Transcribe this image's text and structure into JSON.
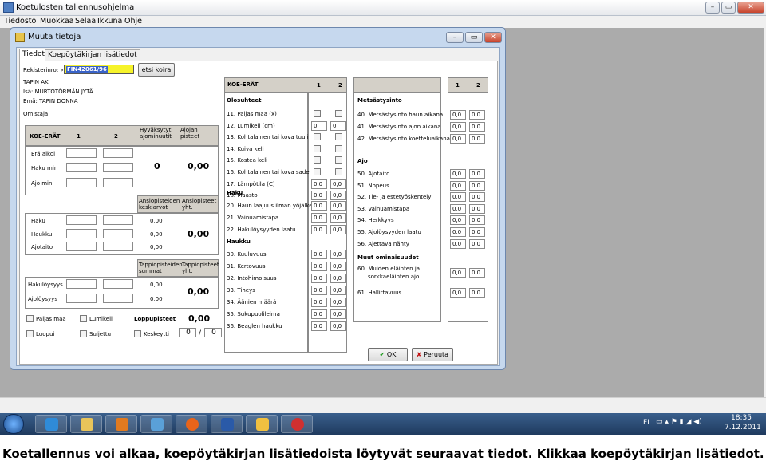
{
  "main_window": {
    "title": "Koetulosten tallennusohjelma",
    "menu": [
      "Tiedosto",
      "Muokkaa",
      "Selaa",
      "Ikkuna",
      "Ohje"
    ]
  },
  "dialog": {
    "title": "Muuta tietoja",
    "tabs": [
      "Tiedot",
      "Koepöytäkirjan lisätiedot"
    ],
    "reg_label": "Rekisterinro: »",
    "reg_value": "FIN42061/96",
    "find_button": "etsi koira",
    "dog_name": "TAPIN AKI",
    "sire": "Isä:   MURTOTÖRMÄN JYTÄ",
    "dam": "Emä:  TAPIN DONNA",
    "owner_label": "Omistaja:",
    "left": {
      "header": "KOE-ERÄT",
      "col1": "1",
      "col2": "2",
      "approved": "Hyväksytyt ajominuutit",
      "drive_pts": "Ajojan pisteet",
      "rows": [
        "Erä alkoi",
        "Haku min",
        "Ajo min"
      ],
      "approved_val": "0",
      "drive_val": "0,00",
      "income_avg": "Ansiopisteiden keskiarvot",
      "income_tot": "Ansiopisteet yht.",
      "income_rows": [
        "Haku",
        "Haukku",
        "Ajotaito"
      ],
      "income_vals": [
        "0,00",
        "0,00",
        "0,00"
      ],
      "income_total": "0,00",
      "loss_sum": "Tappiopisteiden summat",
      "loss_tot": "Tappiopisteet yht.",
      "loss_rows": [
        "Hakulöysyys",
        "Ajolöysyys"
      ],
      "loss_vals": [
        "0,00",
        "0,00"
      ],
      "loss_total": "0,00",
      "checks": [
        [
          "Paljas maa",
          "Lumikeli"
        ],
        [
          "Luopui",
          "Suljettu",
          "Keskeytti"
        ]
      ],
      "final_label": "Loppupisteet",
      "final_val": "0,00",
      "frac": [
        "0",
        "/",
        "0"
      ]
    },
    "mid": {
      "header": "KOE-ERÄT",
      "col1": "1",
      "col2": "2",
      "sec1": "Olosuhteet",
      "conds": [
        "11. Paljas maa (x)",
        "12. Lumikeli (cm)",
        "13. Kohtalainen tai kova tuuli",
        "14. Kuiva keli",
        "15. Kostea keli",
        "16. Kohtalainen tai kova sade",
        "17. Lämpötila (C)",
        "18. Maasto"
      ],
      "cond_vals": {
        "12": [
          "0",
          "0"
        ],
        "17": [
          "0,0",
          "0,0"
        ],
        "18": [
          "0,0",
          "0,0"
        ]
      },
      "sec2": "Haku",
      "haku": [
        "20. Haun laajuus ilman yöjälkeä",
        "21. Vainuamistapa",
        "22. Hakulöysyyden laatu"
      ],
      "sec3": "Haukku",
      "haukku": [
        "30. Kuuluvuus",
        "31. Kertovuus",
        "32. Intohimoisuus",
        "33. Tiheys",
        "34. Äänien määrä",
        "35. Sukupuolileima",
        "36. Beaglen haukku"
      ],
      "val": "0,0"
    },
    "right": {
      "col1": "1",
      "col2": "2",
      "sec1": "Metsästysinto",
      "met": [
        "40. Metsästysinto haun aikana",
        "41. Metsästysinto ajon aikana",
        "42. Metsästysinto koetteluaikana"
      ],
      "sec2": "Ajo",
      "ajo": [
        "50. Ajotaito",
        "51. Nopeus",
        "52. Tie- ja estetyöskentely",
        "53. Vainuamistapa",
        "54. Herkkyys",
        "55. Ajolöysyyden laatu",
        "56. Ajettava nähty"
      ],
      "sec3": "Muut ominaisuudet",
      "muut1a": "60. Muiden eläinten ja",
      "muut1b": "sorkkaeläinten ajo",
      "muut2": "61. Hallittavuus",
      "val": "0,0"
    },
    "ok": "OK",
    "cancel": "Peruuta"
  },
  "tray": {
    "lang": "FI",
    "time": "18:35",
    "date": "7.12.2011"
  },
  "caption": "Koetallennus voi alkaa, koepöytäkirjan lisätiedoista löytyvät seuraavat tiedot. Klikkaa koepöytäkirjan lisätiedot."
}
